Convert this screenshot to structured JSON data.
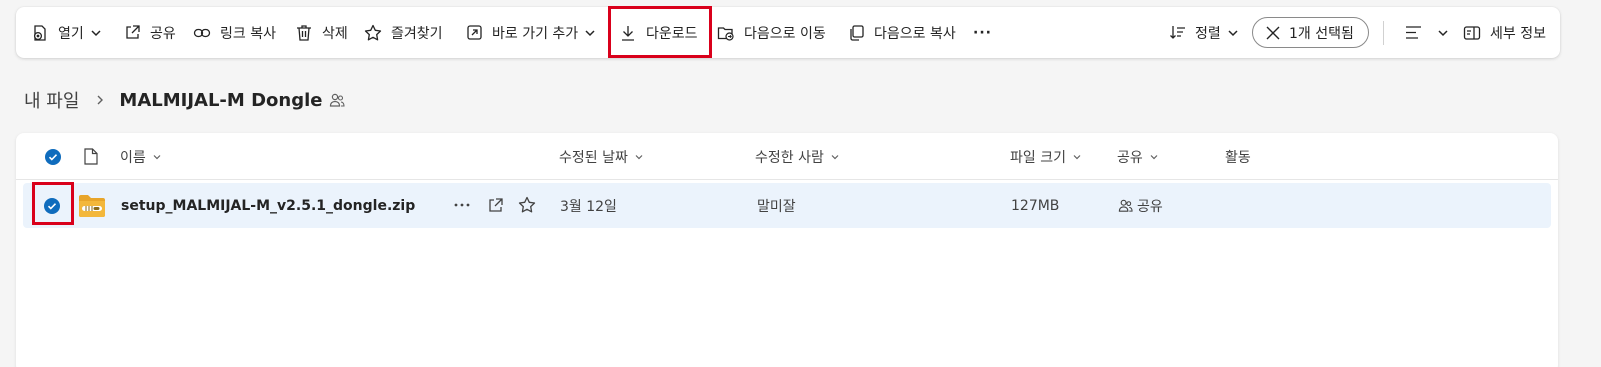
{
  "toolbar": {
    "open": "열기",
    "share": "공유",
    "copy_link": "링크 복사",
    "delete": "삭제",
    "favorite": "즐겨찾기",
    "add_shortcut": "바로 가기 추가",
    "download": "다운로드",
    "move_to": "다음으로 이동",
    "copy_to": "다음으로 복사",
    "more": "···",
    "sort": "정렬",
    "selected": "1개 선택됨",
    "details": "세부 정보"
  },
  "breadcrumb": {
    "root": "내 파일",
    "current": "MALMIJAL-M Dongle"
  },
  "table": {
    "columns": {
      "name": "이름",
      "modified": "수정된 날짜",
      "modified_by": "수정한 사람",
      "size": "파일 크기",
      "sharing": "공유",
      "activity": "활동"
    },
    "rows": [
      {
        "name": "setup_MALMIJAL-M_v2.5.1_dongle.zip",
        "modified": "3월 12일",
        "modified_by": "말미잘",
        "size": "127MB",
        "sharing": "공유",
        "selected": true
      }
    ]
  },
  "colors": {
    "accent": "#0f6cbd",
    "highlight": "#d9001b",
    "selected_row": "#ebf3fc",
    "folder_zip": "#f3b73b"
  }
}
